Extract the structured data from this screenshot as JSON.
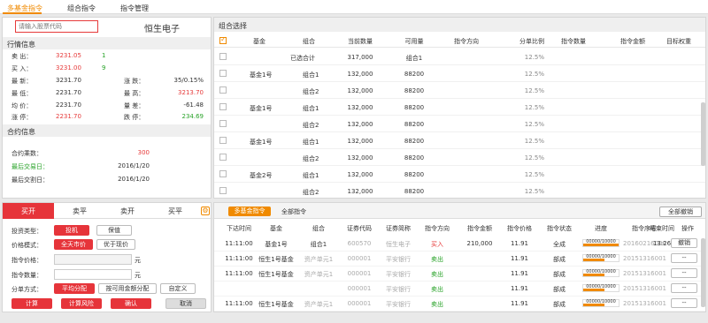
{
  "topnav": {
    "tabs": [
      "多基金指令",
      "组合指令",
      "指令管理"
    ]
  },
  "quote": {
    "search_placeholder": "请输入股票代码",
    "stock_name": "恒生电子",
    "market_title": "行情信息",
    "rows": [
      {
        "l1": "卖 出：",
        "v1": "3231.05",
        "c1": "red",
        "v2": "1",
        "c2": "green",
        "l3": "",
        "v3": ""
      },
      {
        "l1": "买 入：",
        "v1": "3231.00",
        "c1": "red",
        "v2": "9",
        "c2": "green",
        "l3": "",
        "v3": ""
      },
      {
        "l1": "最 新：",
        "v1": "3231.70",
        "c1": "",
        "v2": "",
        "c2": "",
        "l3": "涨 跌：",
        "v3": "35/0.15%",
        "c3": ""
      },
      {
        "l1": "最 低：",
        "v1": "2231.70",
        "c1": "",
        "v2": "",
        "c2": "",
        "l3": "最 高：",
        "v3": "3213.70",
        "c3": "red"
      },
      {
        "l1": "均 价：",
        "v1": "2231.70",
        "c1": "",
        "v2": "",
        "c2": "",
        "l3": "量 差：",
        "v3": "-61.48",
        "c3": ""
      },
      {
        "l1": "涨 停：",
        "v1": "2231.70",
        "c1": "red",
        "v2": "",
        "c2": "",
        "l3": "跌 停：",
        "v3": "234.69",
        "c3": "green"
      }
    ]
  },
  "contract": {
    "title": "合约信息",
    "rows": [
      {
        "label": "合约乘数：",
        "value": "300",
        "lc": "",
        "vc": "red"
      },
      {
        "label": "最后交易日：",
        "value": "2016/1/20",
        "lc": "green",
        "vc": ""
      },
      {
        "label": "最后交割日：",
        "value": "2016/1/20",
        "lc": "",
        "vc": ""
      }
    ]
  },
  "combo": {
    "title": "组合选择",
    "headers": [
      "基金",
      "组合",
      "当前数量",
      "可用量",
      "指令方向",
      "分单比例",
      "指令数量",
      "指令金额",
      "目标权重"
    ],
    "rows": [
      {
        "fund": "",
        "group": "已选合计",
        "qty": "317,000",
        "avail": "组合1",
        "ratio": "12.5%"
      },
      {
        "fund": "基金1号",
        "group": "组合1",
        "qty": "132,000",
        "avail": "88200",
        "ratio": "12.5%"
      },
      {
        "fund": "",
        "group": "组合2",
        "qty": "132,000",
        "avail": "88200",
        "ratio": "12.5%"
      },
      {
        "fund": "基金1号",
        "group": "组合1",
        "qty": "132,000",
        "avail": "88200",
        "ratio": "12.5%"
      },
      {
        "fund": "",
        "group": "组合2",
        "qty": "132,000",
        "avail": "88200",
        "ratio": "12.5%"
      },
      {
        "fund": "基金1号",
        "group": "组合1",
        "qty": "132,000",
        "avail": "88200",
        "ratio": "12.5%"
      },
      {
        "fund": "",
        "group": "组合2",
        "qty": "132,000",
        "avail": "88200",
        "ratio": "12.5%"
      },
      {
        "fund": "基金2号",
        "group": "组合1",
        "qty": "132,000",
        "avail": "88200",
        "ratio": "12.5%"
      },
      {
        "fund": "",
        "group": "组合2",
        "qty": "132,000",
        "avail": "88200",
        "ratio": "12.5%"
      }
    ]
  },
  "order": {
    "tabs": [
      "买开",
      "卖平",
      "卖开",
      "买平"
    ],
    "invest_label": "投资类型：",
    "invest_opts": [
      "投机",
      "保值"
    ],
    "price_mode_label": "价格模式：",
    "price_mode_opts": [
      "全天市价",
      "优于现价"
    ],
    "price_label": "指令价格：",
    "qty_label": "指令数量：",
    "unit": "元",
    "split_label": "分单方式：",
    "split_opts": [
      "平均分配",
      "按可用金额分配",
      "自定义"
    ],
    "actions": [
      "计算",
      "计算风险",
      "确认",
      "取消"
    ]
  },
  "orders": {
    "tabs": [
      "多基金指令",
      "全部指令"
    ],
    "cancel_all": "全部撤销",
    "headers": [
      "下达时间",
      "基金",
      "组合",
      "证券代码",
      "证券简称",
      "指令方向",
      "指令金额",
      "指令价格",
      "指令状态",
      "进度",
      "指令序号",
      "结束时间",
      "操作"
    ],
    "rows": [
      {
        "time": "11:11:00",
        "fund": "基金1号",
        "group": "组合1",
        "code": "600570",
        "name": "恒生电子",
        "dir": "买入",
        "dirc": "red",
        "amount": "210,000",
        "price": "11.91",
        "status": "全成",
        "prog": "00000/10000",
        "pct": 1.0,
        "seq": "20160216006",
        "end": "13:26",
        "op": "撤销"
      },
      {
        "time": "11:11:00",
        "fund": "恒生1号基金",
        "group": "资产单元1",
        "code": "000001",
        "name": "平安银行",
        "dir": "卖出",
        "dirc": "green",
        "amount": "",
        "price": "11.91",
        "status": "部成",
        "prog": "00000/10000",
        "pct": 0.6,
        "seq": "20151316001",
        "end": "",
        "op": "--"
      },
      {
        "time": "11:11:00",
        "fund": "恒生1号基金",
        "group": "资产单元1",
        "code": "000001",
        "name": "平安银行",
        "dir": "卖出",
        "dirc": "green",
        "amount": "",
        "price": "11.91",
        "status": "部成",
        "prog": "00000/10000",
        "pct": 0.6,
        "seq": "20151316001",
        "end": "",
        "op": "--"
      },
      {
        "time": "",
        "fund": "",
        "group": "",
        "code": "000001",
        "name": "平安银行",
        "dir": "卖出",
        "dirc": "green",
        "amount": "",
        "price": "11.91",
        "status": "部成",
        "prog": "00000/10000",
        "pct": 0.6,
        "seq": "20151316001",
        "end": "",
        "op": "--"
      },
      {
        "time": "11:11:00",
        "fund": "恒生1号基金",
        "group": "资产单元1",
        "code": "000001",
        "name": "平安银行",
        "dir": "卖出",
        "dirc": "green",
        "amount": "",
        "price": "11.91",
        "status": "部成",
        "prog": "00000/10000",
        "pct": 0.6,
        "seq": "20151316001",
        "end": "",
        "op": "--"
      }
    ]
  },
  "colors": {
    "accent": "#f08a00",
    "red": "#e63a3a",
    "green": "#29a329"
  }
}
